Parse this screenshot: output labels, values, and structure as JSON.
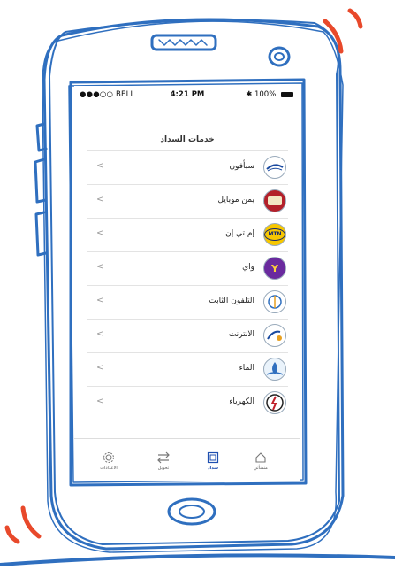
{
  "status_bar": {
    "carrier": "●●●○○ BELL",
    "time": "4:21 PM",
    "battery": "100%"
  },
  "header": {
    "title": "خدمات السداد"
  },
  "services": [
    {
      "label": "سبأفون",
      "icon": "sabafon-logo-icon"
    },
    {
      "label": "يمن موبايل",
      "icon": "yemen-mobile-logo-icon"
    },
    {
      "label": "إم تي إن",
      "icon": "mtn-logo-icon"
    },
    {
      "label": "واي",
      "icon": "y-logo-icon"
    },
    {
      "label": "التلفون الثابت",
      "icon": "landline-logo-icon"
    },
    {
      "label": "الانترنت",
      "icon": "yemennet-logo-icon"
    },
    {
      "label": "الماء",
      "icon": "water-logo-icon"
    },
    {
      "label": "الكهرباء",
      "icon": "electricity-logo-icon"
    }
  ],
  "tab_bar": {
    "settings": "الاعدادات",
    "transfer": "تحويل",
    "payment": "سداد",
    "home": "منشأتي"
  },
  "colors": {
    "sketch_blue": "#2f6fbf",
    "accent_red": "#e8492b",
    "active_tab": "#1f4fb0"
  }
}
